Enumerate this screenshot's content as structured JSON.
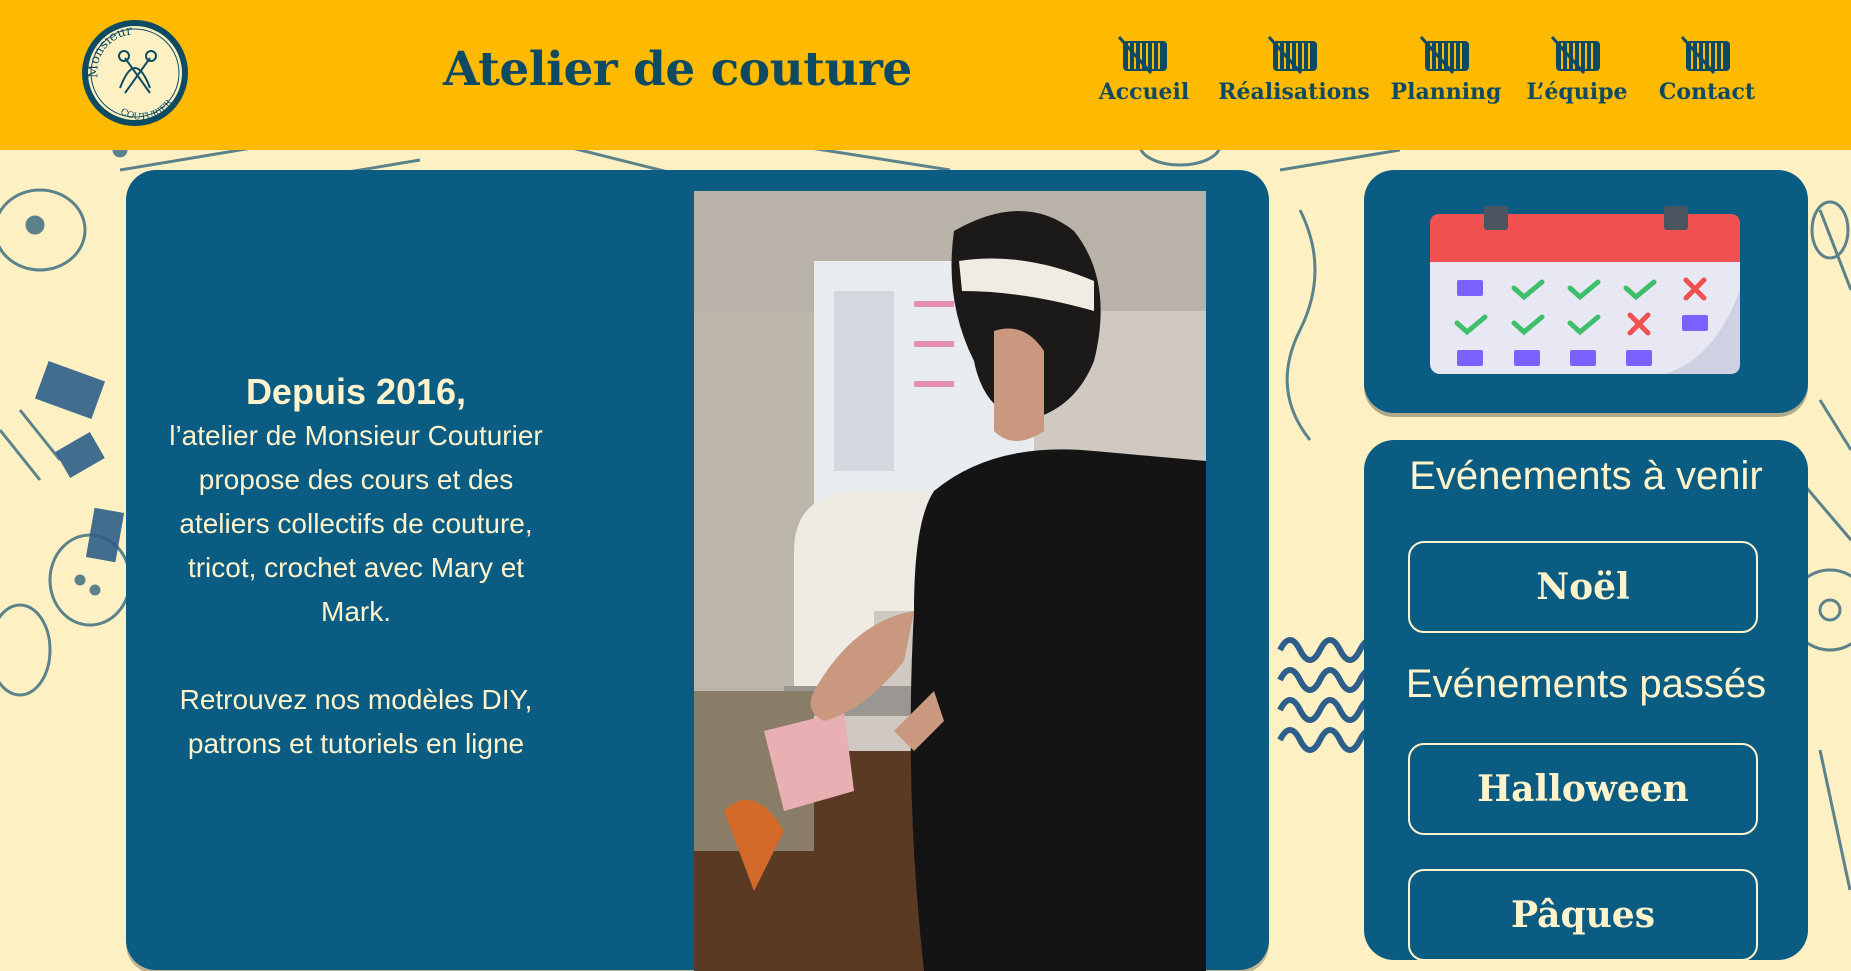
{
  "header": {
    "logo": {
      "line1": "Monsieur",
      "line2": "COUTURIER"
    },
    "title": "Atelier de couture",
    "nav": [
      {
        "label": "Accueil",
        "icon": "thread-spool-icon"
      },
      {
        "label": "Réalisations",
        "icon": "thread-spool-icon"
      },
      {
        "label": "Planning",
        "icon": "thread-spool-icon"
      },
      {
        "label": "L’équipe",
        "icon": "thread-spool-icon"
      },
      {
        "label": "Contact",
        "icon": "thread-spool-icon"
      }
    ]
  },
  "intro": {
    "heading": "Depuis 2016,",
    "paragraph": "l’atelier de Monsieur Couturier propose des cours et des ateliers collectifs de couture, tricot, crochet avec Mary et Mark.",
    "paragraph2": "Retrouvez nos modèles DIY, patrons et tutoriels en ligne"
  },
  "sidebar": {
    "calendar_icon": "calendar-icon",
    "upcoming_heading": "Evénements à venir",
    "upcoming": [
      {
        "label": "Noël"
      }
    ],
    "past_heading": "Evénements passés",
    "past": [
      {
        "label": "Halloween"
      },
      {
        "label": "Pâques"
      }
    ]
  },
  "colors": {
    "header_bg": "#feb901",
    "page_bg": "#fdf1c4",
    "card_bg": "#0b5c82",
    "text_light": "#fff3cc",
    "text_dark": "#0f4a63"
  }
}
